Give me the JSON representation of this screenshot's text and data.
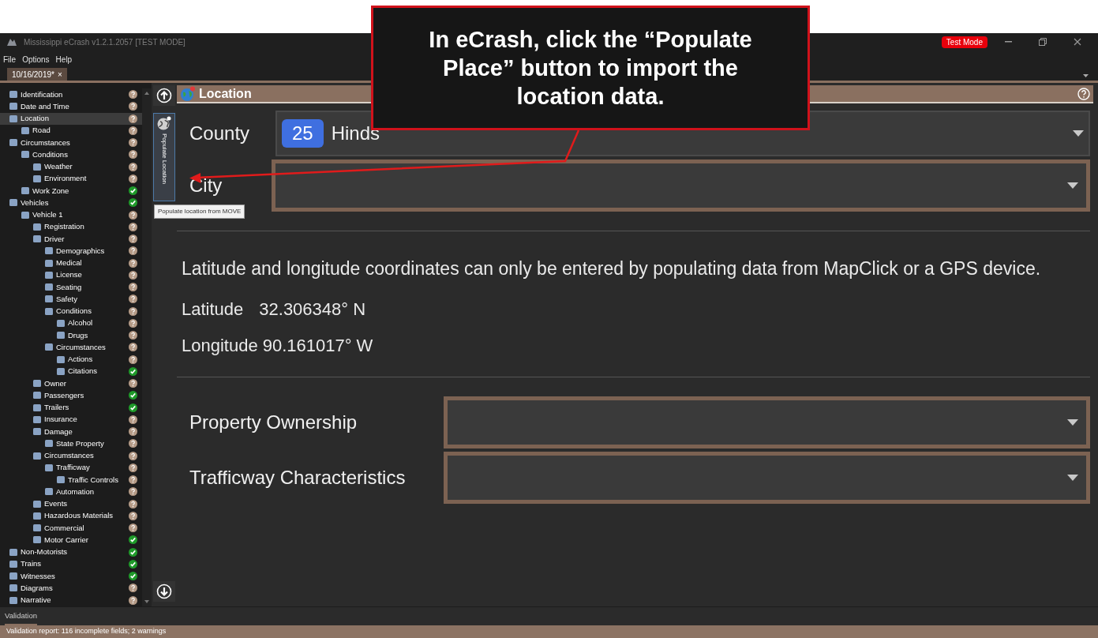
{
  "window": {
    "title": "Mississippi eCrash v1.2.1.2057 [TEST MODE]",
    "badge": "Test Mode"
  },
  "menu": [
    "File",
    "Options",
    "Help"
  ],
  "tabs": [
    {
      "label": "10/16/2019*",
      "close": "×",
      "selected": true
    }
  ],
  "sidebar": {
    "items": [
      {
        "label": "Identification",
        "complete": false,
        "selected": false
      },
      {
        "label": "Date and Time",
        "complete": false,
        "selected": false
      },
      {
        "label": "Location",
        "complete": false,
        "selected": true,
        "children": [
          {
            "label": "Road",
            "complete": false,
            "selected": false
          }
        ]
      },
      {
        "label": "Circumstances",
        "complete": false,
        "selected": false,
        "children": [
          {
            "label": "Conditions",
            "complete": false,
            "selected": false,
            "children": [
              {
                "label": "Weather",
                "complete": false,
                "selected": false
              },
              {
                "label": "Environment",
                "complete": false,
                "selected": false
              }
            ]
          },
          {
            "label": "Work Zone",
            "complete": true,
            "selected": false
          }
        ]
      },
      {
        "label": "Vehicles",
        "complete": true,
        "selected": false,
        "children": [
          {
            "label": "Vehicle 1",
            "complete": false,
            "selected": false,
            "children": [
              {
                "label": "Registration",
                "complete": false,
                "selected": false
              },
              {
                "label": "Driver",
                "complete": false,
                "selected": false,
                "children": [
                  {
                    "label": "Demographics",
                    "complete": false,
                    "selected": false
                  },
                  {
                    "label": "Medical",
                    "complete": false,
                    "selected": false
                  },
                  {
                    "label": "License",
                    "complete": false,
                    "selected": false
                  },
                  {
                    "label": "Seating",
                    "complete": false,
                    "selected": false
                  },
                  {
                    "label": "Safety",
                    "complete": false,
                    "selected": false
                  },
                  {
                    "label": "Conditions",
                    "complete": false,
                    "selected": false,
                    "children": [
                      {
                        "label": "Alcohol",
                        "complete": false,
                        "selected": false
                      },
                      {
                        "label": "Drugs",
                        "complete": false,
                        "selected": false
                      }
                    ]
                  },
                  {
                    "label": "Circumstances",
                    "complete": false,
                    "selected": false,
                    "children": [
                      {
                        "label": "Actions",
                        "complete": false,
                        "selected": false
                      },
                      {
                        "label": "Citations",
                        "complete": true,
                        "selected": false
                      }
                    ]
                  }
                ]
              },
              {
                "label": "Owner",
                "complete": false,
                "selected": false
              },
              {
                "label": "Passengers",
                "complete": true,
                "selected": false
              },
              {
                "label": "Trailers",
                "complete": true,
                "selected": false
              },
              {
                "label": "Insurance",
                "complete": false,
                "selected": false
              },
              {
                "label": "Damage",
                "complete": false,
                "selected": false,
                "children": [
                  {
                    "label": "State Property",
                    "complete": false,
                    "selected": false
                  }
                ]
              },
              {
                "label": "Circumstances",
                "complete": false,
                "selected": false,
                "children": [
                  {
                    "label": "Trafficway",
                    "complete": false,
                    "selected": false,
                    "children": [
                      {
                        "label": "Traffic Controls",
                        "complete": false,
                        "selected": false
                      }
                    ]
                  },
                  {
                    "label": "Automation",
                    "complete": false,
                    "selected": false
                  }
                ]
              },
              {
                "label": "Events",
                "complete": false,
                "selected": false
              },
              {
                "label": "Hazardous Materials",
                "complete": false,
                "selected": false
              },
              {
                "label": "Commercial",
                "complete": false,
                "selected": false
              },
              {
                "label": "Motor Carrier",
                "complete": true,
                "selected": false
              }
            ]
          }
        ]
      },
      {
        "label": "Non-Motorists",
        "complete": true,
        "selected": false
      },
      {
        "label": "Trains",
        "complete": true,
        "selected": false
      },
      {
        "label": "Witnesses",
        "complete": true,
        "selected": false
      },
      {
        "label": "Diagrams",
        "complete": false,
        "selected": false
      },
      {
        "label": "Narrative",
        "complete": false,
        "selected": false
      }
    ]
  },
  "populate_button": {
    "label": "Populate Location",
    "tooltip": "Populate location from MOVE"
  },
  "panel": {
    "title": "Location"
  },
  "county": {
    "label": "County",
    "code": "25",
    "value": "Hinds"
  },
  "city": {
    "label": "City"
  },
  "note": "Latitude and longitude coordinates can only be entered by populating data from MapClick or a GPS device.",
  "latitude": {
    "label": "Latitude",
    "value": "32.306348° N"
  },
  "longitude": {
    "label": "Longitude",
    "value": "90.161017° W"
  },
  "property_ownership": {
    "label": "Property Ownership"
  },
  "trafficway_characteristics": {
    "label": "Trafficway Characteristics"
  },
  "bottom_tab": "Validation",
  "status_bar": "Validation report: 116 incomplete fields; 2 warnings",
  "callout": "In eCrash, click the “Populate Place” button to import the location data."
}
